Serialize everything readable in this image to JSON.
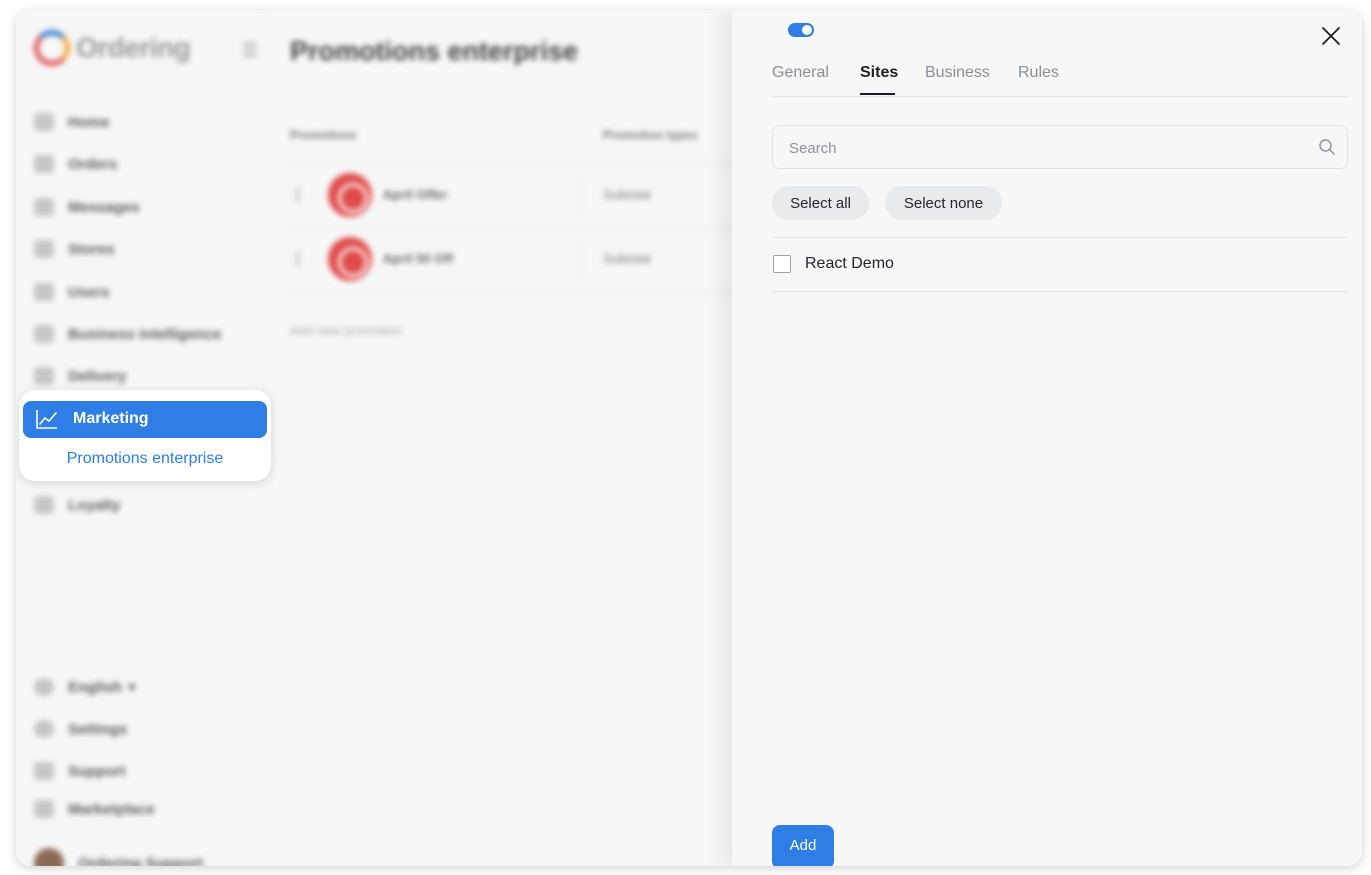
{
  "app": {
    "logo_text": "Ordering"
  },
  "sidebar": {
    "items": [
      {
        "label": "Home",
        "icon": "home-icon"
      },
      {
        "label": "Orders",
        "icon": "list-icon"
      },
      {
        "label": "Messages",
        "icon": "chat-icon"
      },
      {
        "label": "Stores",
        "icon": "store-icon"
      },
      {
        "label": "Users",
        "icon": "users-icon"
      },
      {
        "label": "Business intelligence",
        "icon": "bar-chart-icon"
      },
      {
        "label": "Delivery",
        "icon": "truck-icon"
      },
      {
        "label": "Loyalty",
        "icon": "award-icon"
      }
    ],
    "marketing": {
      "label": "Marketing",
      "icon": "line-chart-icon",
      "active": true
    },
    "marketing_sub": "Promotions enterprise",
    "footer": [
      {
        "label": "English",
        "icon": "globe-icon"
      },
      {
        "label": "Settings",
        "icon": "gear-icon"
      },
      {
        "label": "Support",
        "icon": "headset-icon"
      },
      {
        "label": "Marketplace",
        "icon": "external-link-icon"
      }
    ],
    "user_name": "Ordering Support"
  },
  "main": {
    "title": "Promotions enterprise",
    "columns": [
      "Promotions",
      "Promotion types"
    ],
    "rows": [
      {
        "name": "April Offer",
        "type": "Subtotal"
      },
      {
        "name": "April 50 Off",
        "type": "Subtotal"
      }
    ],
    "add_new": "Add new promotion"
  },
  "drawer": {
    "enabled": true,
    "tabs": [
      {
        "label": "General",
        "active": false
      },
      {
        "label": "Sites",
        "active": true
      },
      {
        "label": "Business",
        "active": false
      },
      {
        "label": "Rules",
        "active": false
      }
    ],
    "search": {
      "placeholder": "Search",
      "value": ""
    },
    "select_all_label": "Select all",
    "select_none_label": "Select none",
    "sites": [
      {
        "name": "React Demo",
        "checked": false
      }
    ],
    "add_label": "Add"
  },
  "colors": {
    "accent": "#2f7ee6",
    "text_primary": "#24262b",
    "text_muted": "#8a8f98",
    "promo_badge": "#e04c4c"
  }
}
